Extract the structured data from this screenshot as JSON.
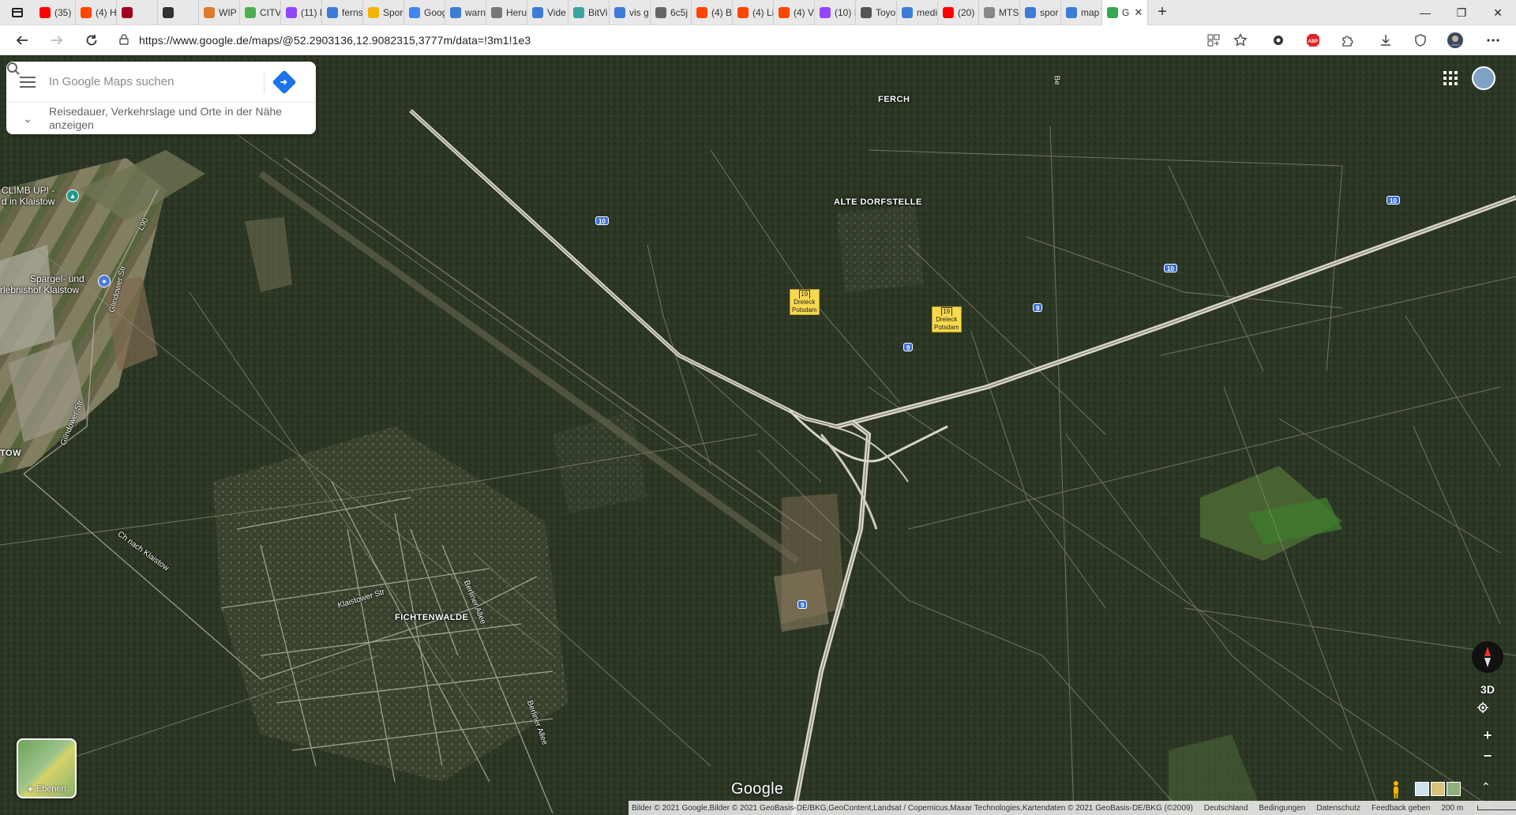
{
  "browser": {
    "tabs": [
      {
        "label": "",
        "color": "#444444",
        "kind": "menu"
      },
      {
        "label": "(35)",
        "color": "#ff0000"
      },
      {
        "label": "(4) H",
        "color": "#ff4500"
      },
      {
        "label": "",
        "color": "#a0001c"
      },
      {
        "label": "",
        "color": "#333333"
      },
      {
        "label": "WIP",
        "color": "#e07a2a"
      },
      {
        "label": "CITV",
        "color": "#4caf50"
      },
      {
        "label": "(11) I",
        "color": "#9146ff"
      },
      {
        "label": "ferns",
        "color": "#3c7bd6"
      },
      {
        "label": "Spor",
        "color": "#f2b400"
      },
      {
        "label": "Goog",
        "color": "#4285f4"
      },
      {
        "label": "warn",
        "color": "#3c7bd6"
      },
      {
        "label": "Heru",
        "color": "#777777"
      },
      {
        "label": "Vide",
        "color": "#3c7bd6"
      },
      {
        "label": "BitVi",
        "color": "#3ba3a3"
      },
      {
        "label": "vis g",
        "color": "#3c7bd6"
      },
      {
        "label": "6c5j",
        "color": "#666666"
      },
      {
        "label": "(4) B",
        "color": "#ff4500"
      },
      {
        "label": "(4) Li",
        "color": "#ff4500"
      },
      {
        "label": "(4) V",
        "color": "#ff4500"
      },
      {
        "label": "(10) I",
        "color": "#9146ff"
      },
      {
        "label": "Toyo",
        "color": "#555555"
      },
      {
        "label": "medi",
        "color": "#3c7bd6"
      },
      {
        "label": "(20)",
        "color": "#ff0000"
      },
      {
        "label": "MTS",
        "color": "#888888"
      },
      {
        "label": "spor",
        "color": "#3c7bd6"
      },
      {
        "label": "map",
        "color": "#3c7bd6"
      },
      {
        "label": "G",
        "color": "#34a853",
        "active": true
      }
    ],
    "new_tab": "+",
    "window_controls": {
      "minimize": "—",
      "maximize": "❐",
      "close": "✕"
    },
    "url": "https://www.google.de/maps/@52.2903136,12.9082315,3777m/data=!3m1!1e3",
    "toolbar_icons": [
      "split-view-icon",
      "favorite-star-icon",
      "extension-icon",
      "adblock-icon",
      "puzzle-icon",
      "download-icon",
      "shield-icon",
      "profile-icon",
      "more-icon"
    ],
    "abp": "ABP"
  },
  "search": {
    "placeholder": "In Google Maps suchen",
    "nearby": "Reisedauer, Verkehrslage und Orte in der Nähe anzeigen"
  },
  "map": {
    "places": {
      "ferch": "FERCH",
      "alte_dorfstelle": "ALTE DORFSTELLE",
      "fichtenwalde": "FICHTENWALDE",
      "tow": "TOW"
    },
    "pois": {
      "climb_line1": "CLIMB UP! -",
      "climb_line2": "d in Klaistow",
      "spargel_line1": "Spargel- und",
      "spargel_line2": "rlebnishof Klaistow"
    },
    "streets": {
      "l90": "L90",
      "glindower_str_1": "Glindower Str",
      "glindower_str_2": "Glindower Str",
      "ch_nach_klaistow": "Ch nach Klaistow",
      "klaistower_str": "Klaistower Str",
      "berliner_allee_1": "Berliner Allee",
      "berliner_allee_2": "Berliner Allee",
      "be": "Be"
    },
    "shields": [
      "10",
      "10",
      "10",
      "9",
      "9",
      "9"
    ],
    "junctions": [
      {
        "num": "19",
        "line1": "Dreieck",
        "line2": "Potsdam"
      },
      {
        "num": "19",
        "line1": "Dreieck",
        "line2": "Potsdam"
      }
    ],
    "layers_label": "Ebenen",
    "google_logo": "Google",
    "controls": {
      "three_d": "3D",
      "zoom_in": "+",
      "zoom_out": "−",
      "expand": "⌃"
    },
    "attribution": {
      "copyright": "Bilder © 2021 Google,Bilder © 2021 GeoBasis-DE/BKG,GeoContent,Landsat / Copernicus,Maxar Technologies,Kartendaten © 2021 GeoBasis-DE/BKG (©2009)",
      "country": "Deutschland",
      "terms": "Bedingungen",
      "privacy": "Datenschutz",
      "feedback": "Feedback geben",
      "scale": "200 m"
    }
  }
}
